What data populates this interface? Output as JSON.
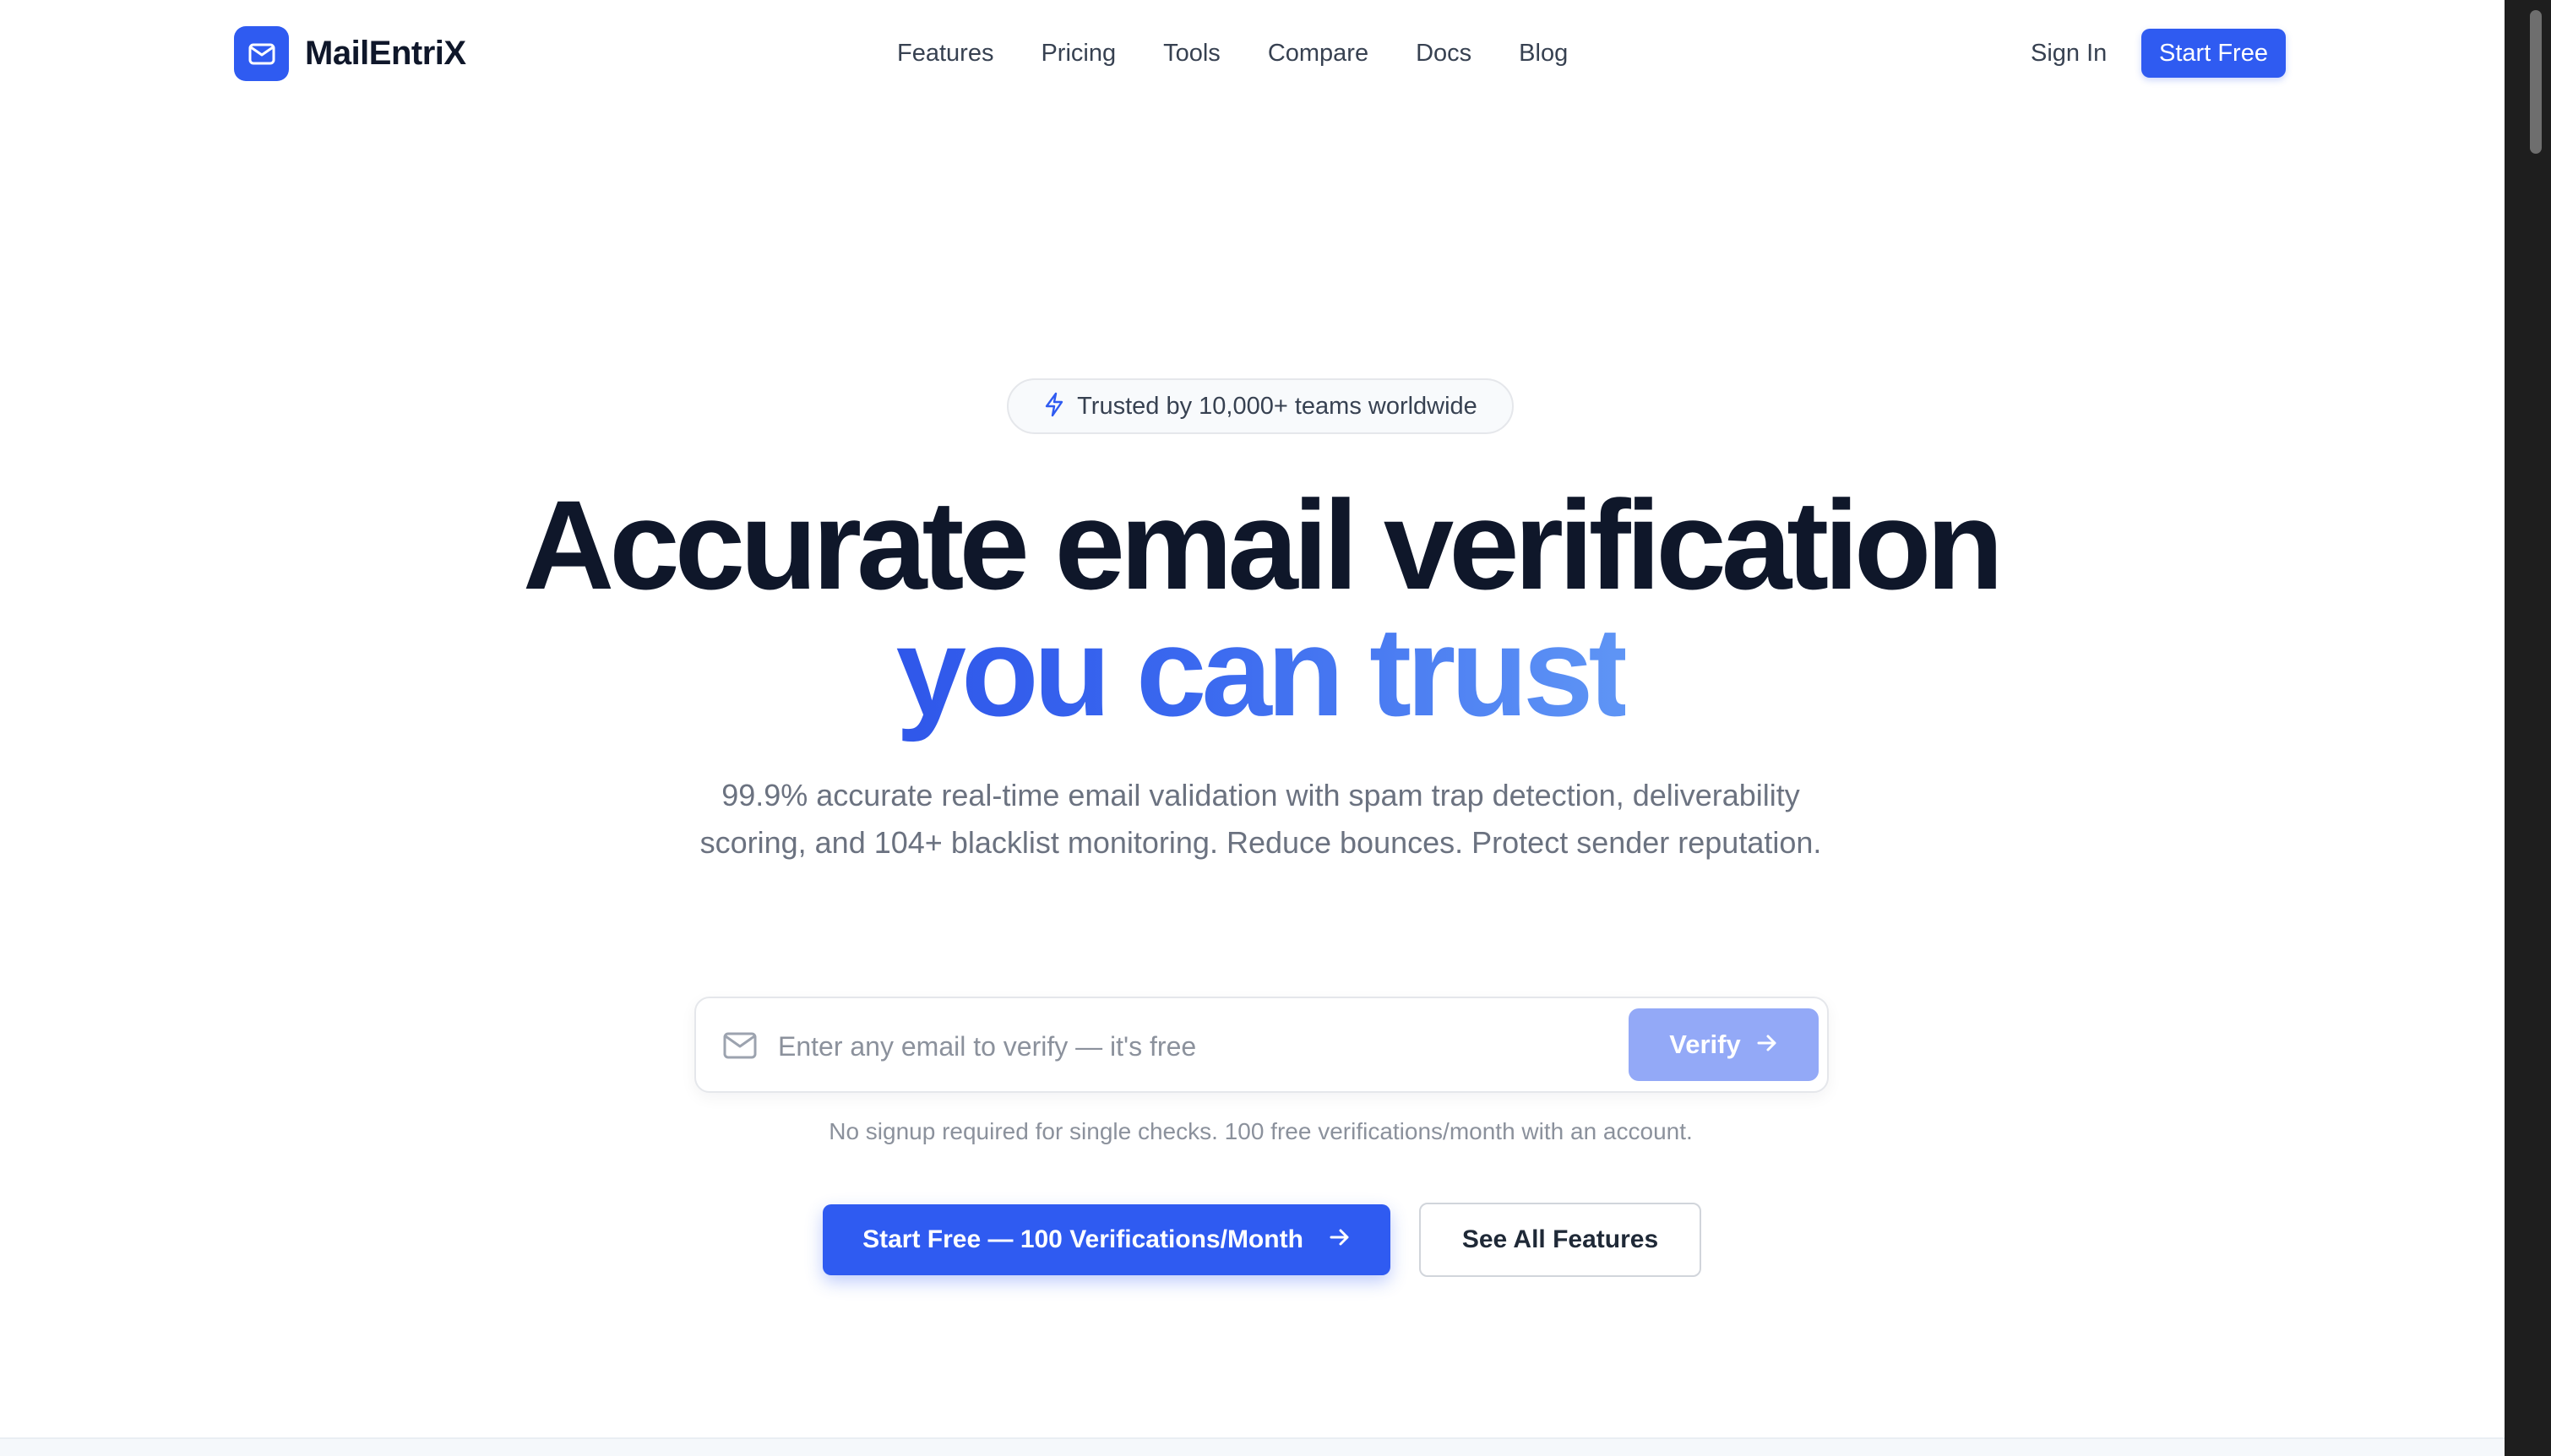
{
  "brand": {
    "name": "MailEntriX",
    "accent": "#2f5bf1",
    "icon": "mail-icon"
  },
  "nav": {
    "links": [
      "Features",
      "Pricing",
      "Tools",
      "Compare",
      "Docs",
      "Blog"
    ],
    "sign_in": "Sign In",
    "start_free": "Start Free"
  },
  "hero": {
    "badge_icon": "lightning-icon",
    "badge": "Trusted by 10,000+ teams worldwide",
    "headline_line1": "Accurate email verification",
    "headline_line2": "you can trust",
    "subtitle": "99.9% accurate real-time email validation with spam trap detection, deliverability scoring, and 104+ blacklist monitoring. Reduce bounces. Protect sender reputation.",
    "verify": {
      "field_icon": "envelope-icon",
      "placeholder": "Enter any email to verify — it's free",
      "value": "",
      "button": "Verify",
      "button_icon": "arrow-right-icon",
      "button_color": "#93a9f7"
    },
    "helper": "No signup required for single checks. 100 free verifications/month with an account.",
    "cta_primary": "Start Free — 100 Verifications/Month",
    "cta_primary_icon": "arrow-right-icon",
    "cta_secondary": "See All Features"
  }
}
